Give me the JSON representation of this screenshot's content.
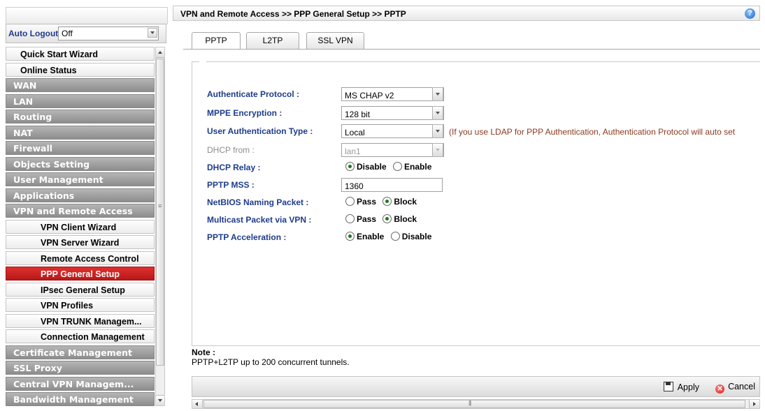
{
  "sidebar": {
    "auto_logout_label": "Auto Logout :",
    "auto_logout_value": "Off",
    "items": [
      {
        "label": "Quick Start Wizard",
        "style": "white"
      },
      {
        "label": "Online Status",
        "style": "white"
      },
      {
        "label": "WAN",
        "style": "grey"
      },
      {
        "label": "LAN",
        "style": "grey"
      },
      {
        "label": "Routing",
        "style": "grey"
      },
      {
        "label": "NAT",
        "style": "grey"
      },
      {
        "label": "Firewall",
        "style": "grey"
      },
      {
        "label": "Objects Setting",
        "style": "grey"
      },
      {
        "label": "User Management",
        "style": "grey"
      },
      {
        "label": "Applications",
        "style": "grey"
      },
      {
        "label": "VPN and Remote Access",
        "style": "grey"
      },
      {
        "label": "VPN Client Wizard",
        "style": "sub"
      },
      {
        "label": "VPN Server Wizard",
        "style": "sub"
      },
      {
        "label": "Remote Access Control",
        "style": "sub"
      },
      {
        "label": "PPP General Setup",
        "style": "active"
      },
      {
        "label": "IPsec General Setup",
        "style": "sub"
      },
      {
        "label": "VPN Profiles",
        "style": "sub"
      },
      {
        "label": "VPN TRUNK Managem...",
        "style": "sub"
      },
      {
        "label": "Connection Management",
        "style": "sub"
      },
      {
        "label": "Certificate Management",
        "style": "grey"
      },
      {
        "label": "SSL Proxy",
        "style": "grey"
      },
      {
        "label": "Central VPN Managem...",
        "style": "grey"
      },
      {
        "label": "Bandwidth Management",
        "style": "grey"
      }
    ]
  },
  "header": {
    "breadcrumb": "VPN and Remote Access >> PPP General Setup >> PPTP",
    "help_glyph": "?"
  },
  "tabs": [
    {
      "label": "PPTP",
      "selected": true
    },
    {
      "label": "L2TP",
      "selected": false
    },
    {
      "label": "SSL VPN",
      "selected": false
    }
  ],
  "form": {
    "authenticate_protocol": {
      "label": "Authenticate Protocol :",
      "value": "MS CHAP v2"
    },
    "mppe_encryption": {
      "label": "MPPE Encryption :",
      "value": "128 bit"
    },
    "user_auth_type": {
      "label": "User Authentication Type :",
      "value": "Local",
      "hint": "(If you use LDAP for PPP Authentication, Authentication Protocol will auto set"
    },
    "dhcp_from": {
      "label": "DHCP from :",
      "value": "lan1"
    },
    "dhcp_relay": {
      "label": "DHCP Relay :",
      "opt1": "Disable",
      "opt2": "Enable",
      "selected": "Disable"
    },
    "pptp_mss": {
      "label": "PPTP MSS :",
      "value": "1360"
    },
    "netbios": {
      "label": "NetBIOS Naming Packet :",
      "opt1": "Pass",
      "opt2": "Block",
      "selected": "Block"
    },
    "multicast": {
      "label": "Multicast Packet via VPN :",
      "opt1": "Pass",
      "opt2": "Block",
      "selected": "Block"
    },
    "pptp_accel": {
      "label": "PPTP Acceleration :",
      "opt1": "Enable",
      "opt2": "Disable",
      "selected": "Enable"
    }
  },
  "note": {
    "title": "Note :",
    "text": "PPTP+L2TP up to 200 concurrent tunnels."
  },
  "footer": {
    "apply_label": "Apply",
    "cancel_label": "Cancel",
    "cancel_glyph": "✕"
  },
  "colors": {
    "active_menu": "#c82020",
    "menu_grey": "#a0a0a0",
    "label_blue": "#1e3c8c",
    "hint_brown": "#8b3a1e"
  }
}
